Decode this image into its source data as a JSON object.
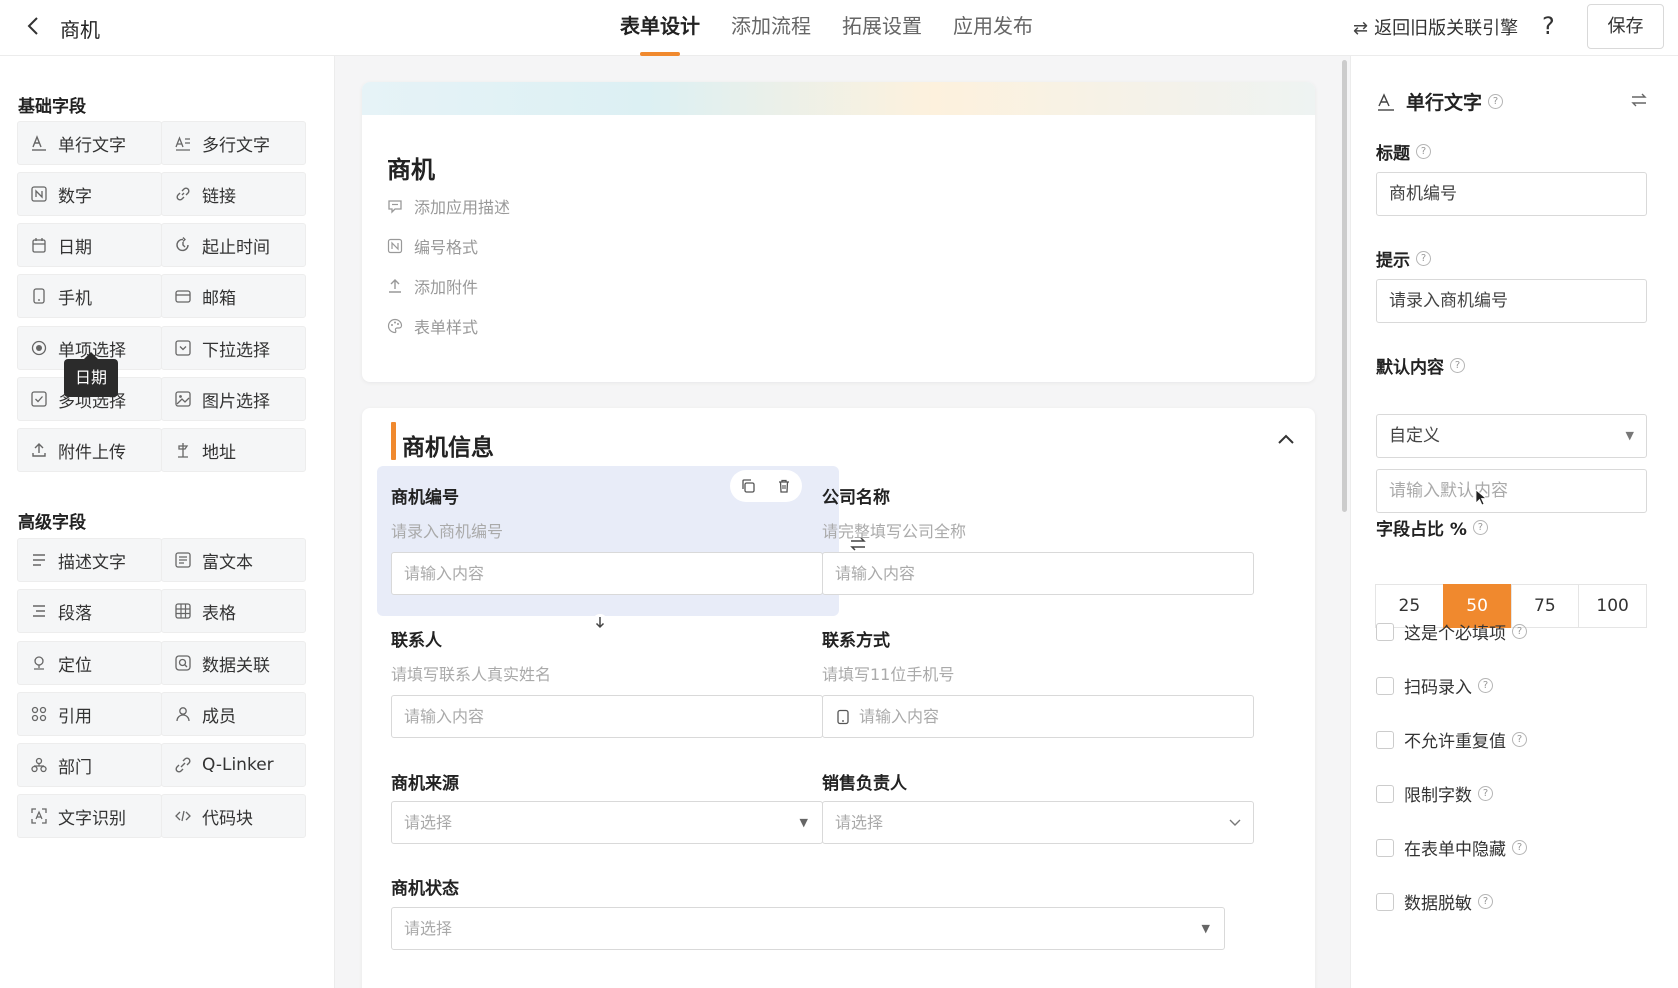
{
  "header": {
    "back_label": "back",
    "title": "商机",
    "tabs": [
      {
        "label": "表单设计",
        "active": true
      },
      {
        "label": "添加流程",
        "active": false
      },
      {
        "label": "拓展设置",
        "active": false
      },
      {
        "label": "应用发布",
        "active": false
      }
    ],
    "revert_label": "返回旧版关联引擎",
    "revert_icon": "⇄",
    "help_label": "?",
    "save_label": "保存"
  },
  "palette": {
    "basic_title": "基础字段",
    "basic": [
      {
        "label": "单行文字",
        "icon": "single-line-text"
      },
      {
        "label": "多行文字",
        "icon": "multi-line-text"
      },
      {
        "label": "数字",
        "icon": "number"
      },
      {
        "label": "链接",
        "icon": "link"
      },
      {
        "label": "日期",
        "icon": "calendar"
      },
      {
        "label": "起止时间",
        "icon": "time-range"
      },
      {
        "label": "手机",
        "icon": "phone"
      },
      {
        "label": "邮箱",
        "icon": "mail"
      },
      {
        "label": "单项选择",
        "icon": "radio"
      },
      {
        "label": "下拉选择",
        "icon": "dropdown"
      },
      {
        "label": "多项选择",
        "icon": "checkbox"
      },
      {
        "label": "图片选择",
        "icon": "image"
      },
      {
        "label": "附件上传",
        "icon": "upload"
      },
      {
        "label": "地址",
        "icon": "location"
      }
    ],
    "advanced_title": "高级字段",
    "advanced": [
      {
        "label": "描述文字",
        "icon": "description"
      },
      {
        "label": "富文本",
        "icon": "rich-text"
      },
      {
        "label": "段落",
        "icon": "paragraph"
      },
      {
        "label": "表格",
        "icon": "table"
      },
      {
        "label": "定位",
        "icon": "locate"
      },
      {
        "label": "数据关联",
        "icon": "data-link"
      },
      {
        "label": "引用",
        "icon": "reference"
      },
      {
        "label": "成员",
        "icon": "member"
      },
      {
        "label": "部门",
        "icon": "department"
      },
      {
        "label": "Q-Linker",
        "icon": "q-linker"
      },
      {
        "label": "文字识别",
        "icon": "ocr"
      },
      {
        "label": "代码块",
        "icon": "code"
      }
    ],
    "tooltip": "日期"
  },
  "form": {
    "title": "商机",
    "meta": [
      {
        "label": "添加应用描述",
        "icon": "comment"
      },
      {
        "label": "编号格式",
        "icon": "number-format"
      },
      {
        "label": "添加附件",
        "icon": "upload"
      },
      {
        "label": "表单样式",
        "icon": "palette"
      }
    ],
    "section_title": "商机信息",
    "fields": [
      {
        "label": "商机编号",
        "hint": "请录入商机编号",
        "placeholder": "请输入内容"
      },
      {
        "label": "公司名称",
        "hint": "请完整填写公司全称",
        "placeholder": "请输入内容"
      },
      {
        "label": "联系人",
        "hint": "请填写联系人真实姓名",
        "placeholder": "请输入内容"
      },
      {
        "label": "联系方式",
        "hint": "请填写11位手机号",
        "placeholder": "请输入内容"
      },
      {
        "label": "商机来源",
        "placeholder": "请选择"
      },
      {
        "label": "销售负责人",
        "placeholder": "请选择"
      },
      {
        "label": "商机状态",
        "placeholder": "请选择"
      }
    ]
  },
  "props": {
    "type_title": "单行文字",
    "title_label": "标题",
    "title_value": "商机编号",
    "hint_label": "提示",
    "hint_value": "请录入商机编号",
    "default_label": "默认内容",
    "default_mode": "自定义",
    "default_placeholder": "请输入默认内容",
    "width_label": "字段占比 %",
    "width_options": [
      "25",
      "50",
      "75",
      "100"
    ],
    "width_selected": "50",
    "checks": [
      {
        "label": "这是个必填项",
        "checked": false
      },
      {
        "label": "扫码录入",
        "checked": false
      },
      {
        "label": "不允许重复值",
        "checked": false
      },
      {
        "label": "限制字数",
        "checked": false
      },
      {
        "label": "在表单中隐藏",
        "checked": false
      },
      {
        "label": "数据脱敏",
        "checked": false
      }
    ]
  },
  "colors": {
    "accent": "#f0892e",
    "selected_field_bg": "#e8ecf8"
  }
}
